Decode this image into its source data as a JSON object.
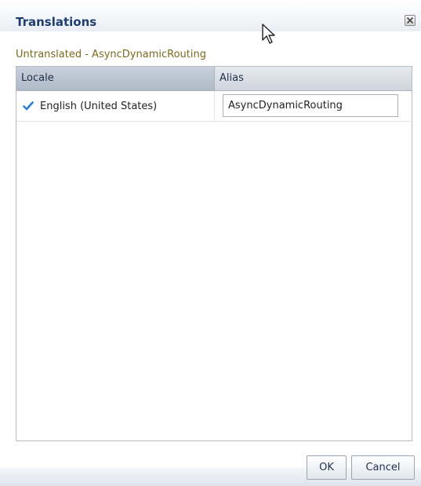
{
  "dialog": {
    "title": "Translations",
    "subtitle": "Untranslated - AsyncDynamicRouting"
  },
  "table": {
    "columns": [
      "Locale",
      "Alias"
    ],
    "rows": [
      {
        "locale": "English (United States)",
        "alias": "AsyncDynamicRouting",
        "checked": true
      }
    ]
  },
  "buttons": {
    "ok": "OK",
    "cancel": "Cancel"
  },
  "icons": {
    "close": "close-icon",
    "check": "checkmark-icon",
    "cursor": "mouse-pointer-icon"
  },
  "colors": {
    "title": "#1e3e6f",
    "subtitle": "#7a6a1e",
    "check": "#2a7fd4"
  }
}
